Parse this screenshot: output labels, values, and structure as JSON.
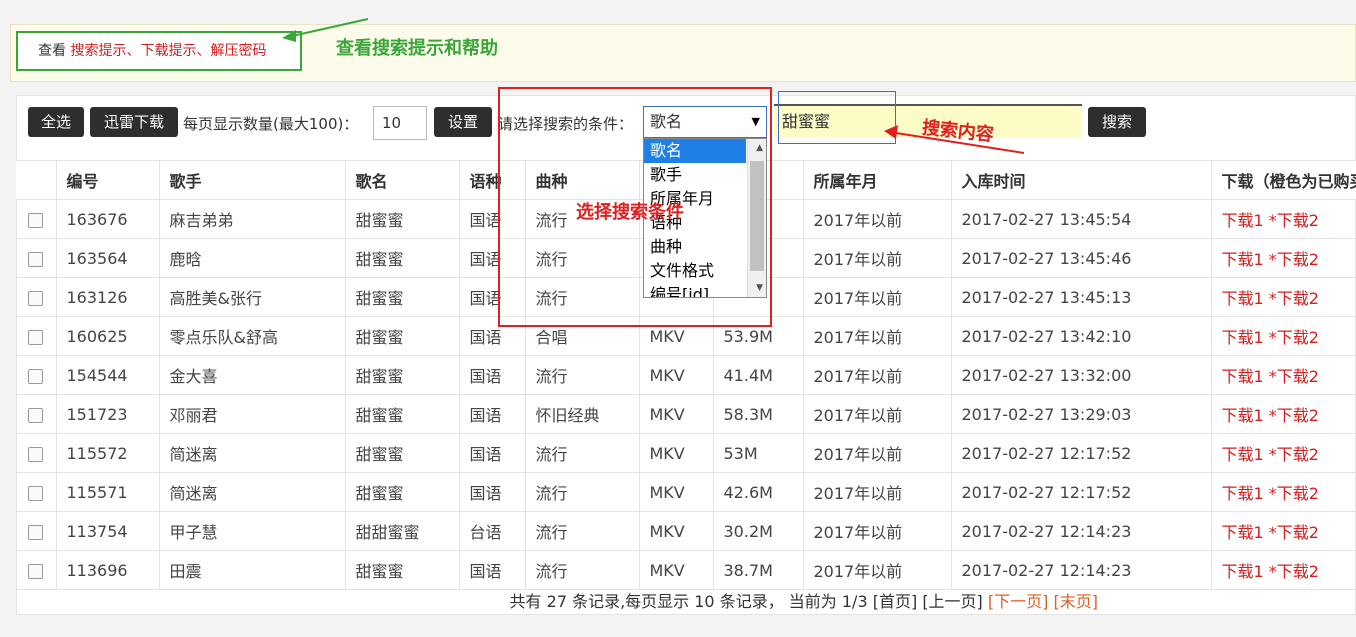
{
  "help": {
    "lead": "查看",
    "links": "搜索提示、下载提示、解压密码",
    "annotation": "查看搜索提示和帮助"
  },
  "toolbar": {
    "select_all": "全选",
    "thunder_download": "迅雷下载",
    "page_size_label": "每页显示数量(最大100)：",
    "page_size_value": "10",
    "set_button": "设置",
    "condition_label": "请选择搜索的条件：",
    "condition_selected": "歌名",
    "condition_options": [
      "歌名",
      "歌手",
      "所属年月",
      "语种",
      "曲种",
      "文件格式",
      "编号[id]"
    ],
    "search_value": "甜蜜蜜",
    "search_button": "搜索"
  },
  "annotations": {
    "search_content": "搜索内容",
    "select_condition": "选择搜索条件"
  },
  "table": {
    "headers": [
      "编号",
      "歌手",
      "歌名",
      "语种",
      "曲种",
      "",
      "",
      "所属年月",
      "入库时间",
      "下载（橙色为已购买"
    ],
    "rows": [
      [
        "163676",
        "麻吉弟弟",
        "甜蜜蜜",
        "国语",
        "流行",
        "",
        "",
        "2017年以前",
        "2017-02-27 13:45:54"
      ],
      [
        "163564",
        "鹿晗",
        "甜蜜蜜",
        "国语",
        "流行",
        "",
        "",
        "2017年以前",
        "2017-02-27 13:45:46"
      ],
      [
        "163126",
        "高胜美&张行",
        "甜蜜蜜",
        "国语",
        "流行",
        "",
        "",
        "2017年以前",
        "2017-02-27 13:45:13"
      ],
      [
        "160625",
        "零点乐队&舒高",
        "甜蜜蜜",
        "国语",
        "合唱",
        "MKV",
        "53.9M",
        "2017年以前",
        "2017-02-27 13:42:10"
      ],
      [
        "154544",
        "金大喜",
        "甜蜜蜜",
        "国语",
        "流行",
        "MKV",
        "41.4M",
        "2017年以前",
        "2017-02-27 13:32:00"
      ],
      [
        "151723",
        "邓丽君",
        "甜蜜蜜",
        "国语",
        "怀旧经典",
        "MKV",
        "58.3M",
        "2017年以前",
        "2017-02-27 13:29:03"
      ],
      [
        "115572",
        "简迷离",
        "甜蜜蜜",
        "国语",
        "流行",
        "MKV",
        "53M",
        "2017年以前",
        "2017-02-27 12:17:52"
      ],
      [
        "115571",
        "简迷离",
        "甜蜜蜜",
        "国语",
        "流行",
        "MKV",
        "42.6M",
        "2017年以前",
        "2017-02-27 12:17:52"
      ],
      [
        "113754",
        "甲子慧",
        "甜甜蜜蜜",
        "台语",
        "流行",
        "MKV",
        "30.2M",
        "2017年以前",
        "2017-02-27 12:14:23"
      ],
      [
        "113696",
        "田震",
        "甜蜜蜜",
        "国语",
        "流行",
        "MKV",
        "38.7M",
        "2017年以前",
        "2017-02-27 12:14:23"
      ]
    ],
    "download_1": "下载1",
    "download_2": "*下载2"
  },
  "pager": {
    "summary": "共有 27 条记录,每页显示 10 条记录， 当前为 1/3",
    "first": "[首页]",
    "prev": "[上一页]",
    "next": "[下一页]",
    "last": "[末页]"
  }
}
